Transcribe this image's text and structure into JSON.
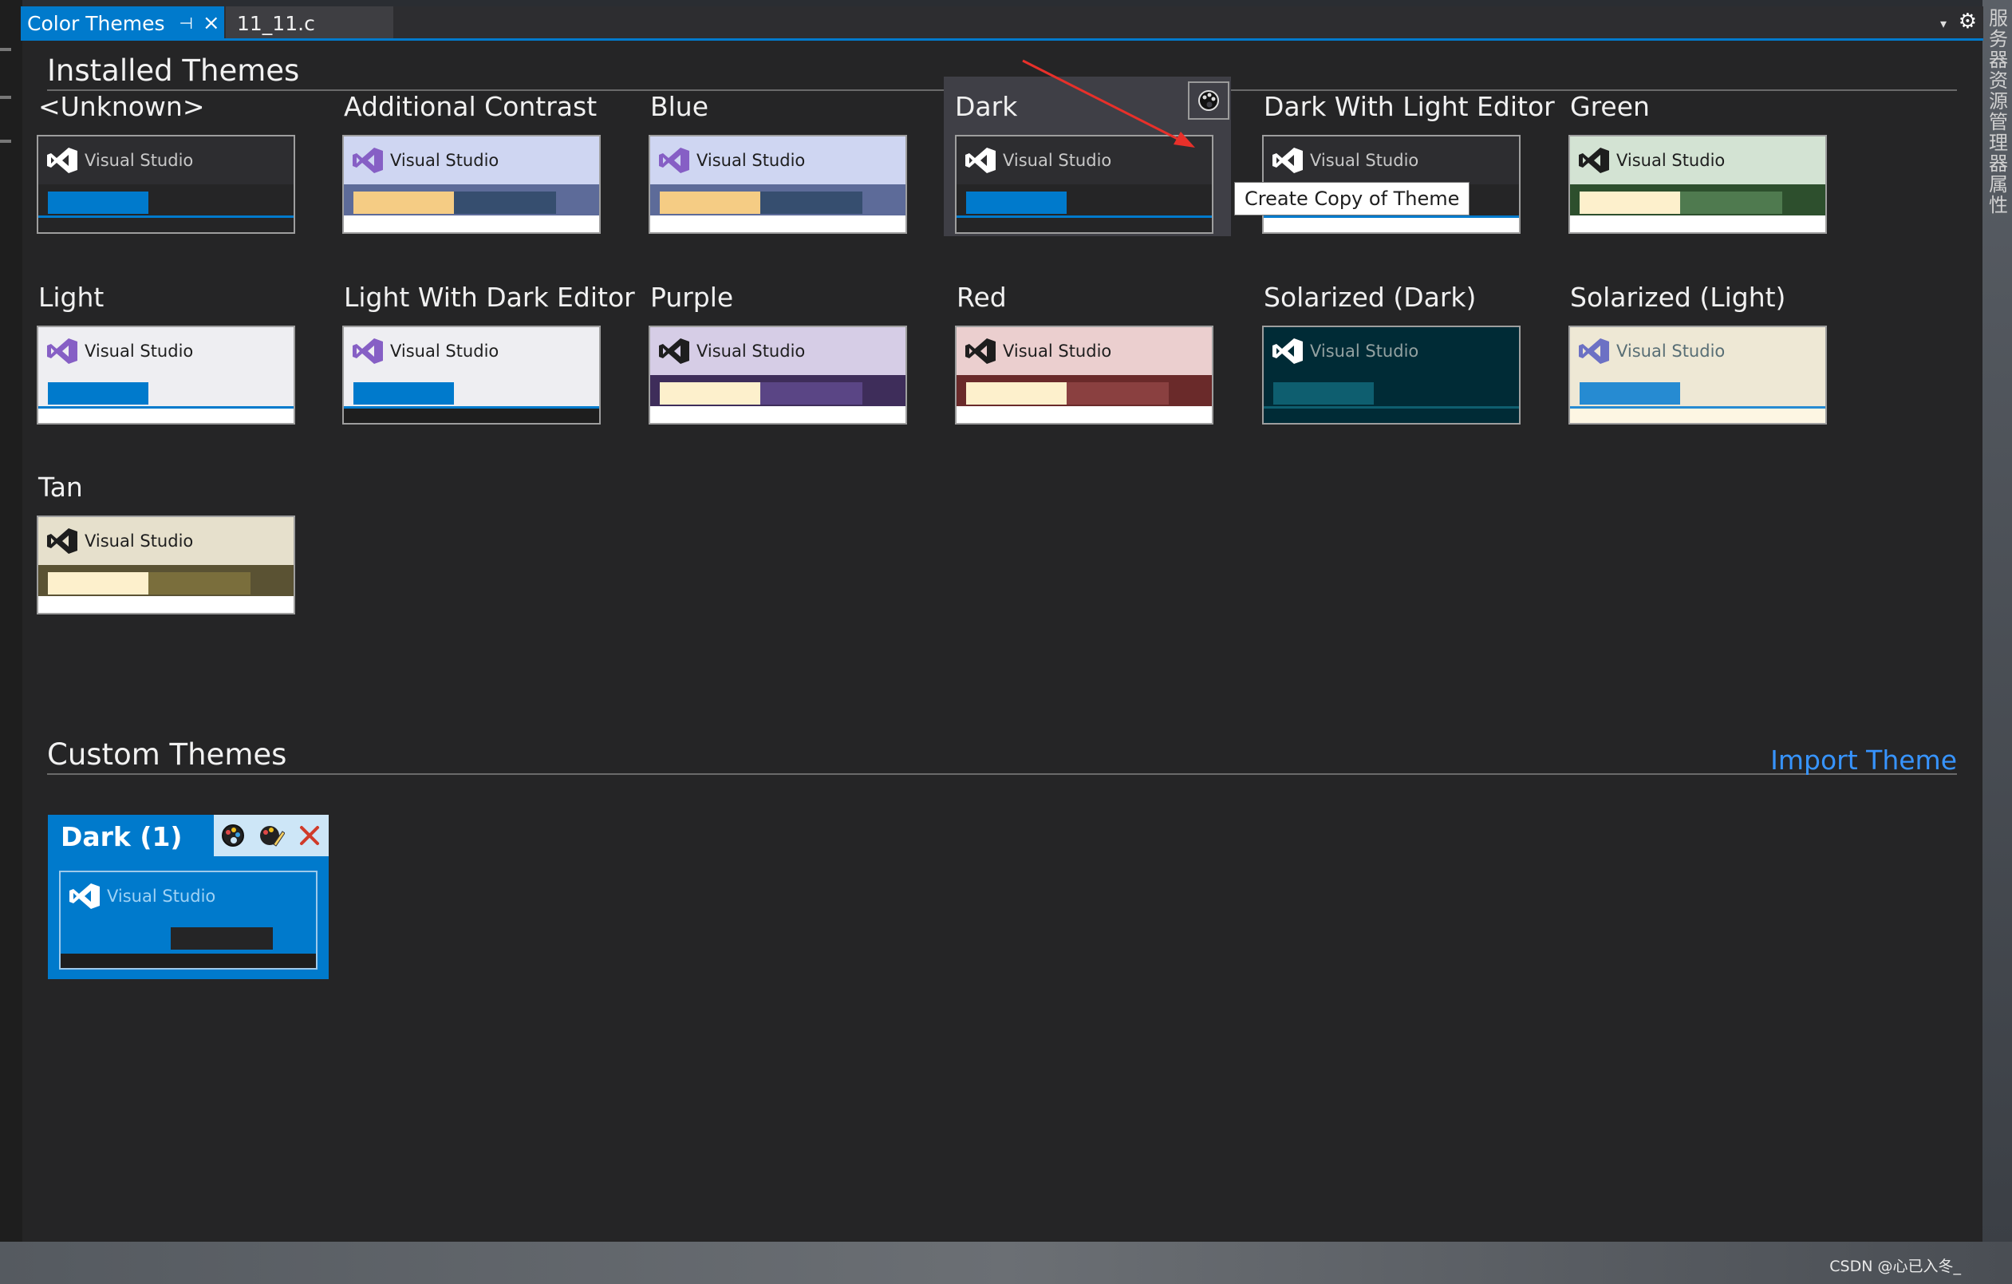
{
  "tabs": {
    "active_label": "Color Themes",
    "pin_glyph": "⊣",
    "close_glyph": "×",
    "other_label": "11_11.c"
  },
  "window": {
    "dropdown_glyph": "▾",
    "gear_glyph": "⚙"
  },
  "installed": {
    "title": "Installed Themes",
    "tooltip": "Create Copy of Theme",
    "themes": [
      {
        "name": "<Unknown>",
        "head": "#2d2d30",
        "text": "#c8c8c8",
        "bar": "#252526",
        "b1": "#007acc",
        "b2": "#252526",
        "foot": "#252526",
        "line": "#007acc",
        "logo": "#ffffff"
      },
      {
        "name": "Additional Contrast",
        "head": "#cfd6f2",
        "text": "#1e1e1e",
        "bar": "#5d6b99",
        "b1": "#f5cc84",
        "b2": "#364e6f",
        "foot": "#ffffff",
        "line": "#ffffff",
        "logo": "#865fc5"
      },
      {
        "name": "Blue",
        "head": "#cfd6f2",
        "text": "#1e1e1e",
        "bar": "#5d6b99",
        "b1": "#f5cc84",
        "b2": "#364e6f",
        "foot": "#ffffff",
        "line": "#ffffff",
        "logo": "#865fc5"
      },
      {
        "name": "Dark",
        "head": "#2d2d30",
        "text": "#c8c8c8",
        "bar": "#252526",
        "b1": "#007acc",
        "b2": "#252526",
        "foot": "#252526",
        "line": "#007acc",
        "logo": "#ffffff"
      },
      {
        "name": "Dark With Light Editor",
        "head": "#2d2d30",
        "text": "#c8c8c8",
        "bar": "#252526",
        "b1": "#007acc",
        "b2": "#252526",
        "foot": "#ffffff",
        "line": "#007acc",
        "logo": "#ffffff"
      },
      {
        "name": "Green",
        "head": "#d3e3d3",
        "text": "#1e1e1e",
        "bar": "#2d4f2d",
        "b1": "#fdf0cc",
        "b2": "#4f7a4f",
        "foot": "#ffffff",
        "line": "#ffffff",
        "logo": "#1e1e1e"
      },
      {
        "name": "Light",
        "head": "#eeeef2",
        "text": "#1e1e1e",
        "bar": "#eeeef2",
        "b1": "#007acc",
        "b2": "#eeeef2",
        "foot": "#ffffff",
        "line": "#007acc",
        "logo": "#865fc5"
      },
      {
        "name": "Light With Dark Editor",
        "head": "#eeeef2",
        "text": "#1e1e1e",
        "bar": "#eeeef2",
        "b1": "#007acc",
        "b2": "#eeeef2",
        "foot": "#1e1e1e",
        "line": "#007acc",
        "logo": "#865fc5"
      },
      {
        "name": "Purple",
        "head": "#d6cde6",
        "text": "#1e1e1e",
        "bar": "#3e2d5a",
        "b1": "#fdf0cc",
        "b2": "#5a4585",
        "foot": "#ffffff",
        "line": "#ffffff",
        "logo": "#1e1e1e"
      },
      {
        "name": "Red",
        "head": "#ebcfcf",
        "text": "#1e1e1e",
        "bar": "#6a2a2a",
        "b1": "#fdf0cc",
        "b2": "#8a4040",
        "foot": "#ffffff",
        "line": "#ffffff",
        "logo": "#1e1e1e"
      },
      {
        "name": "Solarized (Dark)",
        "head": "#002b36",
        "text": "#93a1a1",
        "bar": "#002b36",
        "b1": "#0e5e6f",
        "b2": "#002b36",
        "foot": "#002b36",
        "line": "#0e5e6f",
        "logo": "#ffffff"
      },
      {
        "name": "Solarized (Light)",
        "head": "#eee8d5",
        "text": "#586e75",
        "bar": "#eee8d5",
        "b1": "#268bd2",
        "b2": "#eee8d5",
        "foot": "#fdf6e3",
        "line": "#268bd2",
        "logo": "#6c71c4"
      },
      {
        "name": "Tan",
        "head": "#e6e0cc",
        "text": "#1e1e1e",
        "bar": "#5a5233",
        "b1": "#fdf0cc",
        "b2": "#7a6e3c",
        "foot": "#ffffff",
        "line": "#ffffff",
        "logo": "#1e1e1e"
      }
    ],
    "preview_label": "Visual Studio"
  },
  "custom": {
    "title": "Custom Themes",
    "import_label": "Import Theme",
    "themes": [
      {
        "name": "Dark (1)",
        "head": "#007acc",
        "text": "#9fd2f5",
        "bar": "#007acc",
        "b1": "#007acc",
        "b2": "#252526",
        "foot": "#1e1e1e",
        "line": "#007acc",
        "logo": "#ffffff"
      }
    ]
  },
  "watermark": "CSDN @心已入冬_",
  "side_panel_text": "服务器资源管理器 属性"
}
